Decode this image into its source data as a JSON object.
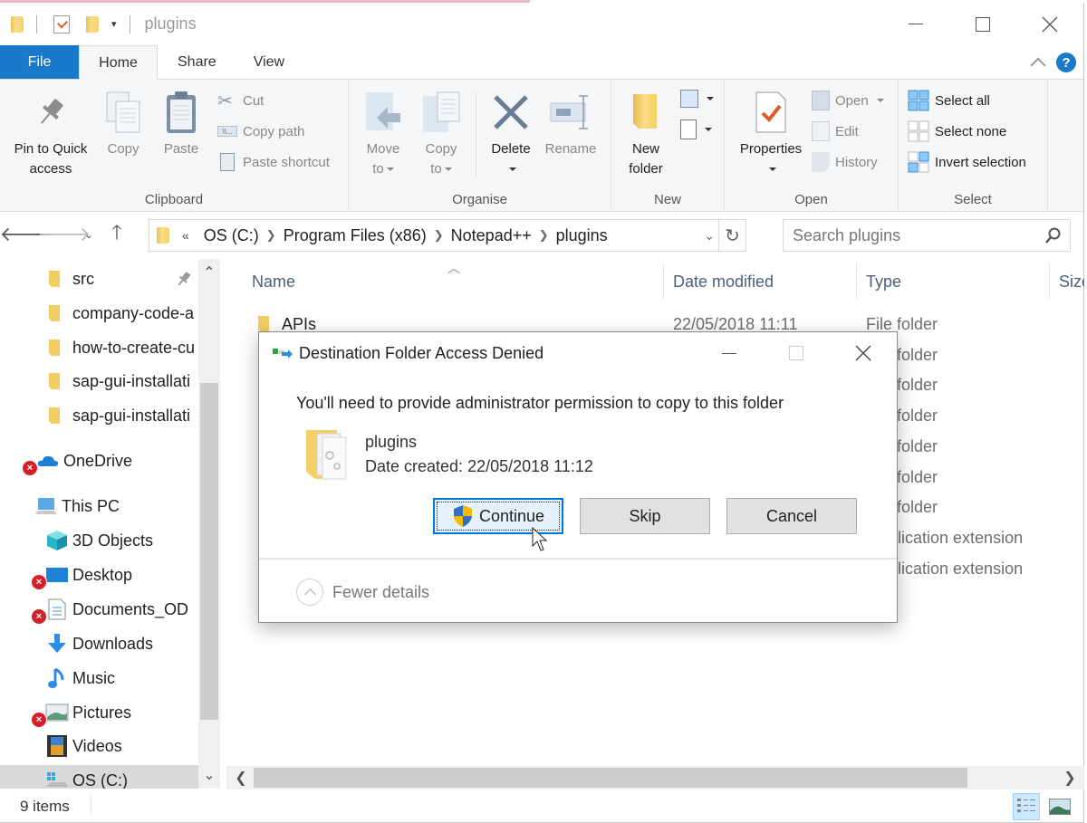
{
  "window": {
    "title": "plugins",
    "controls": {
      "minimize": "minimize",
      "maximize": "maximize",
      "close": "close"
    }
  },
  "tabs": [
    {
      "label": "File",
      "state": "file"
    },
    {
      "label": "Home",
      "state": "active"
    },
    {
      "label": "Share",
      "state": "normal"
    },
    {
      "label": "View",
      "state": "normal"
    }
  ],
  "help_label": "?",
  "ribbon": {
    "clipboard": {
      "label": "Clipboard",
      "pin": "Pin to Quick",
      "pin2": "access",
      "copy": "Copy",
      "paste": "Paste",
      "cut": "Cut",
      "copy_path": "Copy path",
      "paste_shortcut": "Paste shortcut"
    },
    "organise": {
      "label": "Organise",
      "move": "Move",
      "move2": "to",
      "copy": "Copy",
      "copy2": "to",
      "delete": "Delete",
      "rename": "Rename"
    },
    "new": {
      "label": "New",
      "new_folder": "New",
      "new_folder2": "folder"
    },
    "open": {
      "label": "Open",
      "properties": "Properties",
      "open": "Open",
      "edit": "Edit",
      "history": "History"
    },
    "select": {
      "label": "Select",
      "select_all": "Select all",
      "select_none": "Select none",
      "invert": "Invert selection"
    }
  },
  "address": {
    "overflow": "«",
    "crumbs": [
      "OS (C:)",
      "Program Files (x86)",
      "Notepad++",
      "plugins"
    ],
    "search_placeholder": "Search plugins"
  },
  "navpane": {
    "items": [
      {
        "label": "src",
        "icon": "folder",
        "pinned": true
      },
      {
        "label": "company-code-a",
        "icon": "folder"
      },
      {
        "label": "how-to-create-cu",
        "icon": "folder"
      },
      {
        "label": "sap-gui-installati",
        "icon": "folder"
      },
      {
        "label": "sap-gui-installati",
        "icon": "folder"
      },
      {
        "label": "OneDrive",
        "icon": "onedrive",
        "error": true
      },
      {
        "label": "This PC",
        "icon": "pc"
      },
      {
        "label": "3D Objects",
        "icon": "cube"
      },
      {
        "label": "Desktop",
        "icon": "desktop",
        "error": true
      },
      {
        "label": "Documents_OD",
        "icon": "document",
        "error": true
      },
      {
        "label": "Downloads",
        "icon": "download"
      },
      {
        "label": "Music",
        "icon": "music"
      },
      {
        "label": "Pictures",
        "icon": "pictures",
        "error": true
      },
      {
        "label": "Videos",
        "icon": "videos"
      },
      {
        "label": "OS (C:)",
        "icon": "drive",
        "selected": true
      }
    ]
  },
  "filelist": {
    "columns": [
      "Name",
      "Date modified",
      "Type",
      "Size"
    ],
    "rows": [
      {
        "name": "APIs",
        "date": "22/05/2018 11:11",
        "type": "File folder"
      },
      {
        "name": "",
        "date": "",
        "type": "folder"
      },
      {
        "name": "",
        "date": "",
        "type": "folder"
      },
      {
        "name": "",
        "date": "",
        "type": "folder"
      },
      {
        "name": "",
        "date": "",
        "type": "folder"
      },
      {
        "name": "",
        "date": "",
        "type": "folder"
      },
      {
        "name": "",
        "date": "",
        "type": "folder"
      },
      {
        "name": "",
        "date": "",
        "type": "lication extension"
      },
      {
        "name": "",
        "date": "",
        "type": "lication extension"
      }
    ]
  },
  "status": {
    "items": "9 items"
  },
  "dialog": {
    "title": "Destination Folder Access Denied",
    "message": "You'll need to provide administrator permission to copy to this folder",
    "item_name": "plugins",
    "item_date": "Date created: 22/05/2018 11:12",
    "continue": "Continue",
    "skip": "Skip",
    "cancel": "Cancel",
    "fewer_details": "Fewer details"
  }
}
